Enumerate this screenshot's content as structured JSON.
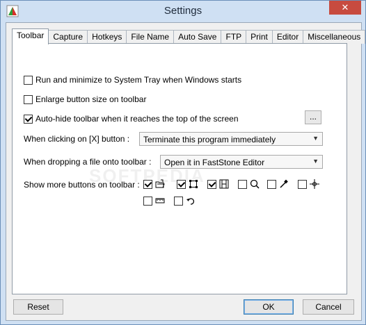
{
  "window": {
    "title": "Settings",
    "close": "✕"
  },
  "tabs": [
    "Toolbar",
    "Capture",
    "Hotkeys",
    "File Name",
    "Auto Save",
    "FTP",
    "Print",
    "Editor",
    "Miscellaneous"
  ],
  "options": {
    "minimize_to_tray": {
      "label": "Run and minimize to System Tray when Windows starts",
      "checked": false
    },
    "enlarge_buttons": {
      "label": "Enlarge button size on toolbar",
      "checked": false
    },
    "auto_hide": {
      "label": "Auto-hide toolbar when it reaches the top of the screen",
      "checked": true,
      "more_label": "..."
    }
  },
  "close_action": {
    "label": "When clicking on [X] button :",
    "value": "Terminate this program immediately"
  },
  "drop_action": {
    "label": "When dropping a file onto toolbar :",
    "value": "Open it in FastStone Editor"
  },
  "more_buttons": {
    "label": "Show more buttons on toolbar :",
    "items": [
      {
        "icon": "open-folder-icon",
        "checked": true
      },
      {
        "icon": "crop-icon",
        "checked": true
      },
      {
        "icon": "film-icon",
        "checked": true
      },
      {
        "icon": "magnifier-icon",
        "checked": false
      },
      {
        "icon": "eyedropper-icon",
        "checked": false
      },
      {
        "icon": "crosshair-icon",
        "checked": false
      },
      {
        "icon": "ruler-icon",
        "checked": false
      },
      {
        "icon": "undo-arrow-icon",
        "checked": false
      }
    ]
  },
  "buttons": {
    "reset": "Reset",
    "ok": "OK",
    "cancel": "Cancel"
  },
  "watermark": "SOFTPEDIA"
}
